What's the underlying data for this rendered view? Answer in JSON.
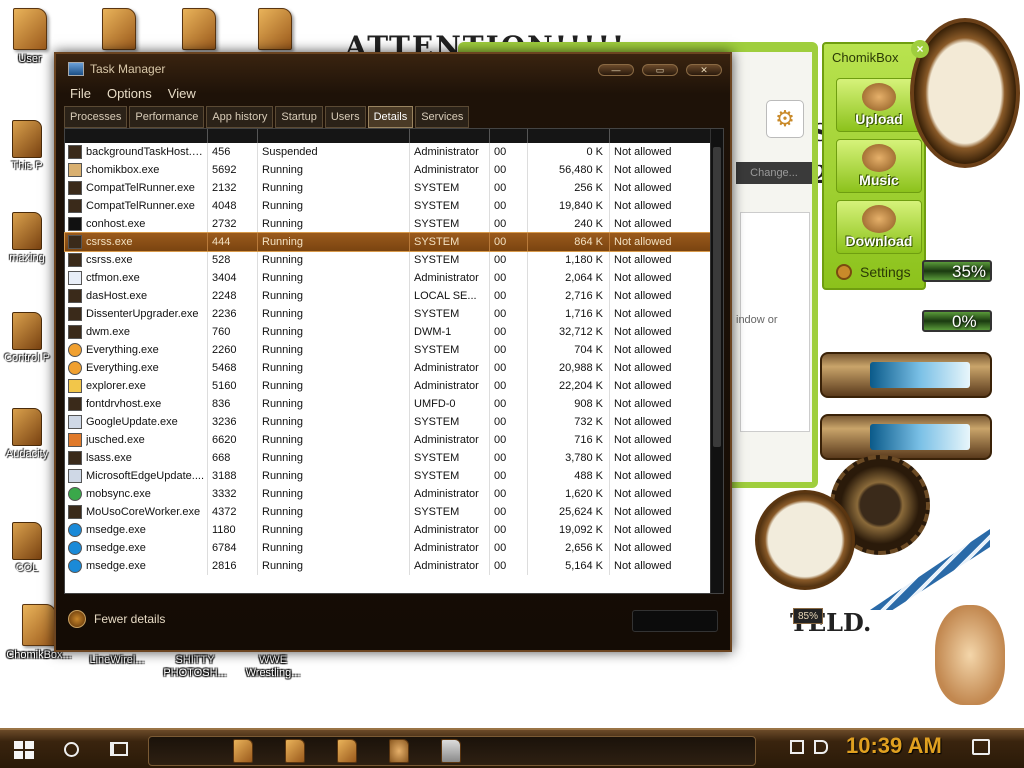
{
  "desktop": {
    "attention_text": "ATTENTION!!!!!",
    "bottom_text": "TELD.",
    "side_letters": [
      "S",
      "2"
    ],
    "top_icons": [
      {
        "label": "User"
      },
      {
        "label": ""
      },
      {
        "label": ""
      },
      {
        "label": ""
      }
    ],
    "left_icons": [
      {
        "label": "This P"
      },
      {
        "label": "maxing"
      },
      {
        "label": "Control P"
      },
      {
        "label": "Audacity"
      },
      {
        "label": "COL"
      }
    ],
    "bottom_icons": [
      {
        "label": "ChomikBox..."
      },
      {
        "label": "LineWirel..."
      },
      {
        "label": "SHITTY PHOTOSH..."
      },
      {
        "label": "WWE Wrestling..."
      }
    ]
  },
  "task_manager": {
    "title": "Task Manager",
    "menu": [
      "File",
      "Options",
      "View"
    ],
    "tabs": [
      "Processes",
      "Performance",
      "App history",
      "Startup",
      "Users",
      "Details",
      "Services"
    ],
    "active_tab": "Details",
    "rows": [
      {
        "name": "backgroundTaskHost.e...",
        "pid": "456",
        "status": "Suspended",
        "user": "Administrator",
        "cpu": "00",
        "mem": "0 K",
        "uac": "Not allowed",
        "icon": "app-icon"
      },
      {
        "name": "chomikbox.exe",
        "pid": "5692",
        "status": "Running",
        "user": "Administrator",
        "cpu": "00",
        "mem": "56,480 K",
        "uac": "Not allowed",
        "icon": "chomikbox-icon"
      },
      {
        "name": "CompatTelRunner.exe",
        "pid": "2132",
        "status": "Running",
        "user": "SYSTEM",
        "cpu": "00",
        "mem": "256 K",
        "uac": "Not allowed",
        "icon": "app-icon"
      },
      {
        "name": "CompatTelRunner.exe",
        "pid": "4048",
        "status": "Running",
        "user": "SYSTEM",
        "cpu": "00",
        "mem": "19,840 K",
        "uac": "Not allowed",
        "icon": "app-icon"
      },
      {
        "name": "conhost.exe",
        "pid": "2732",
        "status": "Running",
        "user": "SYSTEM",
        "cpu": "00",
        "mem": "240 K",
        "uac": "Not allowed",
        "icon": "console-icon"
      },
      {
        "name": "csrss.exe",
        "pid": "444",
        "status": "Running",
        "user": "SYSTEM",
        "cpu": "00",
        "mem": "864 K",
        "uac": "Not allowed",
        "icon": "app-icon",
        "selected": true
      },
      {
        "name": "csrss.exe",
        "pid": "528",
        "status": "Running",
        "user": "SYSTEM",
        "cpu": "00",
        "mem": "1,180 K",
        "uac": "Not allowed",
        "icon": "app-icon"
      },
      {
        "name": "ctfmon.exe",
        "pid": "3404",
        "status": "Running",
        "user": "Administrator",
        "cpu": "00",
        "mem": "2,064 K",
        "uac": "Not allowed",
        "icon": "pen-icon"
      },
      {
        "name": "dasHost.exe",
        "pid": "2248",
        "status": "Running",
        "user": "LOCAL SE...",
        "cpu": "00",
        "mem": "2,716 K",
        "uac": "Not allowed",
        "icon": "app-icon"
      },
      {
        "name": "DissenterUpgrader.exe",
        "pid": "2236",
        "status": "Running",
        "user": "SYSTEM",
        "cpu": "00",
        "mem": "1,716 K",
        "uac": "Not allowed",
        "icon": "app-icon"
      },
      {
        "name": "dwm.exe",
        "pid": "760",
        "status": "Running",
        "user": "DWM-1",
        "cpu": "00",
        "mem": "32,712 K",
        "uac": "Not allowed",
        "icon": "app-icon"
      },
      {
        "name": "Everything.exe",
        "pid": "2260",
        "status": "Running",
        "user": "SYSTEM",
        "cpu": "00",
        "mem": "704 K",
        "uac": "Not allowed",
        "icon": "magnifier-icon"
      },
      {
        "name": "Everything.exe",
        "pid": "5468",
        "status": "Running",
        "user": "Administrator",
        "cpu": "00",
        "mem": "20,988 K",
        "uac": "Not allowed",
        "icon": "magnifier-icon"
      },
      {
        "name": "explorer.exe",
        "pid": "5160",
        "status": "Running",
        "user": "Administrator",
        "cpu": "00",
        "mem": "22,204 K",
        "uac": "Not allowed",
        "icon": "folder-icon"
      },
      {
        "name": "fontdrvhost.exe",
        "pid": "836",
        "status": "Running",
        "user": "UMFD-0",
        "cpu": "00",
        "mem": "908 K",
        "uac": "Not allowed",
        "icon": "app-icon"
      },
      {
        "name": "GoogleUpdate.exe",
        "pid": "3236",
        "status": "Running",
        "user": "SYSTEM",
        "cpu": "00",
        "mem": "732 K",
        "uac": "Not allowed",
        "icon": "installer-icon"
      },
      {
        "name": "jusched.exe",
        "pid": "6620",
        "status": "Running",
        "user": "Administrator",
        "cpu": "00",
        "mem": "716 K",
        "uac": "Not allowed",
        "icon": "java-icon"
      },
      {
        "name": "lsass.exe",
        "pid": "668",
        "status": "Running",
        "user": "SYSTEM",
        "cpu": "00",
        "mem": "3,780 K",
        "uac": "Not allowed",
        "icon": "app-icon"
      },
      {
        "name": "MicrosoftEdgeUpdate....",
        "pid": "3188",
        "status": "Running",
        "user": "SYSTEM",
        "cpu": "00",
        "mem": "488 K",
        "uac": "Not allowed",
        "icon": "installer-icon"
      },
      {
        "name": "mobsync.exe",
        "pid": "3332",
        "status": "Running",
        "user": "Administrator",
        "cpu": "00",
        "mem": "1,620 K",
        "uac": "Not allowed",
        "icon": "sync-icon"
      },
      {
        "name": "MoUsoCoreWorker.exe",
        "pid": "4372",
        "status": "Running",
        "user": "SYSTEM",
        "cpu": "00",
        "mem": "25,624 K",
        "uac": "Not allowed",
        "icon": "app-icon"
      },
      {
        "name": "msedge.exe",
        "pid": "1180",
        "status": "Running",
        "user": "Administrator",
        "cpu": "00",
        "mem": "19,092 K",
        "uac": "Not allowed",
        "icon": "edge-icon"
      },
      {
        "name": "msedge.exe",
        "pid": "6784",
        "status": "Running",
        "user": "Administrator",
        "cpu": "00",
        "mem": "2,656 K",
        "uac": "Not allowed",
        "icon": "edge-icon"
      },
      {
        "name": "msedge.exe",
        "pid": "2816",
        "status": "Running",
        "user": "Administrator",
        "cpu": "00",
        "mem": "5,164 K",
        "uac": "Not allowed",
        "icon": "edge-icon"
      }
    ],
    "footer": {
      "fewer_details": "Fewer details"
    }
  },
  "chomikbox_window": {
    "change_button": "Change...",
    "partial_text": "indow or"
  },
  "chomikbox_panel": {
    "title": "ChomikBox",
    "upload": "Upload",
    "music": "Music",
    "download": "Download",
    "settings": "Settings"
  },
  "gadgets": {
    "gauge1_label": "35%",
    "gauge2_label": "0%",
    "gauge1_value": 0.35,
    "gauge2_value": 0.0,
    "pressure_label": "85%"
  },
  "taskbar": {
    "time": "10:39 AM"
  },
  "colors": {
    "selection": "#8a4e16",
    "chomik_green": "#9fce3d",
    "clock_orange": "#e0a020"
  }
}
